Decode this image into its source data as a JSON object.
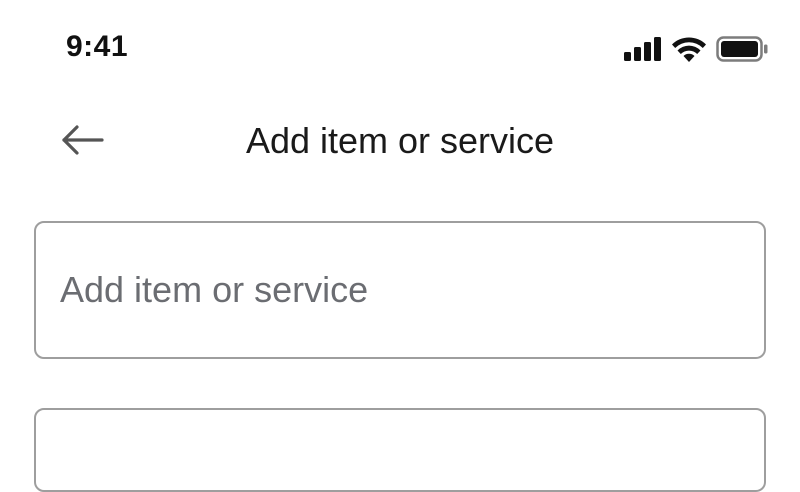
{
  "status_bar": {
    "time": "9:41",
    "icons": [
      "cellular-signal-icon",
      "wifi-icon",
      "battery-icon"
    ]
  },
  "header": {
    "back_icon": "back-arrow-icon",
    "title": "Add item or service"
  },
  "form": {
    "item_field": {
      "placeholder": "Add item or service",
      "value": ""
    },
    "second_field": {
      "placeholder": "",
      "value": ""
    }
  }
}
